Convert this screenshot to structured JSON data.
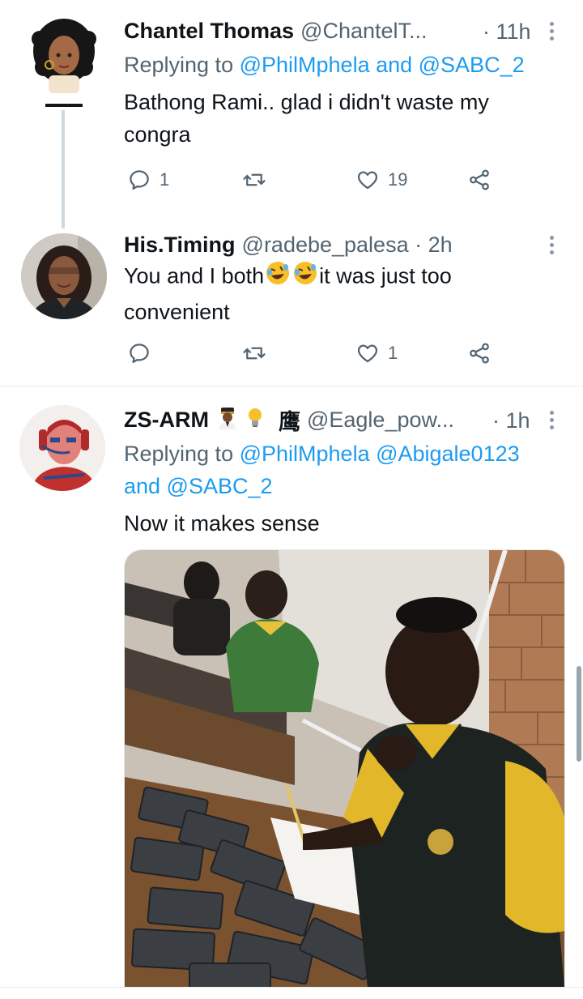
{
  "tweets": [
    {
      "name": "Chantel Thomas",
      "handle": "@ChantelT...",
      "time": "· 11h",
      "replying_prefix": "Replying to ",
      "replying_to": "@PhilMphela and @SABC_2",
      "text": "Bathong Rami.. glad i didn't waste my congra",
      "replies": "1",
      "retweets": "",
      "likes": "19"
    },
    {
      "name": "His.Timing",
      "handle": "@radebe_palesa · 2h",
      "time": "",
      "text_before_emoji": "You and I both",
      "text_after_emoji": "it was just too convenient",
      "replies": "",
      "retweets": "",
      "likes": "1"
    },
    {
      "name": "ZS-ARM",
      "name_symbol": "鹰",
      "handle": "@Eagle_pow...",
      "time": "· 1h",
      "replying_prefix": "Replying to ",
      "replying_to": "@PhilMphela @Abigale0123 and @SABC_2",
      "text": "Now it makes sense"
    }
  ],
  "icons": {
    "reply": "speech-bubble",
    "retweet": "retweet-arrows",
    "like": "heart-outline",
    "share": "share-nodes",
    "more": "vertical-ellipsis",
    "emoji": "rolling-on-floor-laughing",
    "name_emojis": [
      "pilot",
      "light-bulb"
    ]
  },
  "colors": {
    "link": "#1d9bf0",
    "secondary_text": "#536471",
    "primary_text": "#0f1419",
    "divider": "#e6ecf0"
  }
}
